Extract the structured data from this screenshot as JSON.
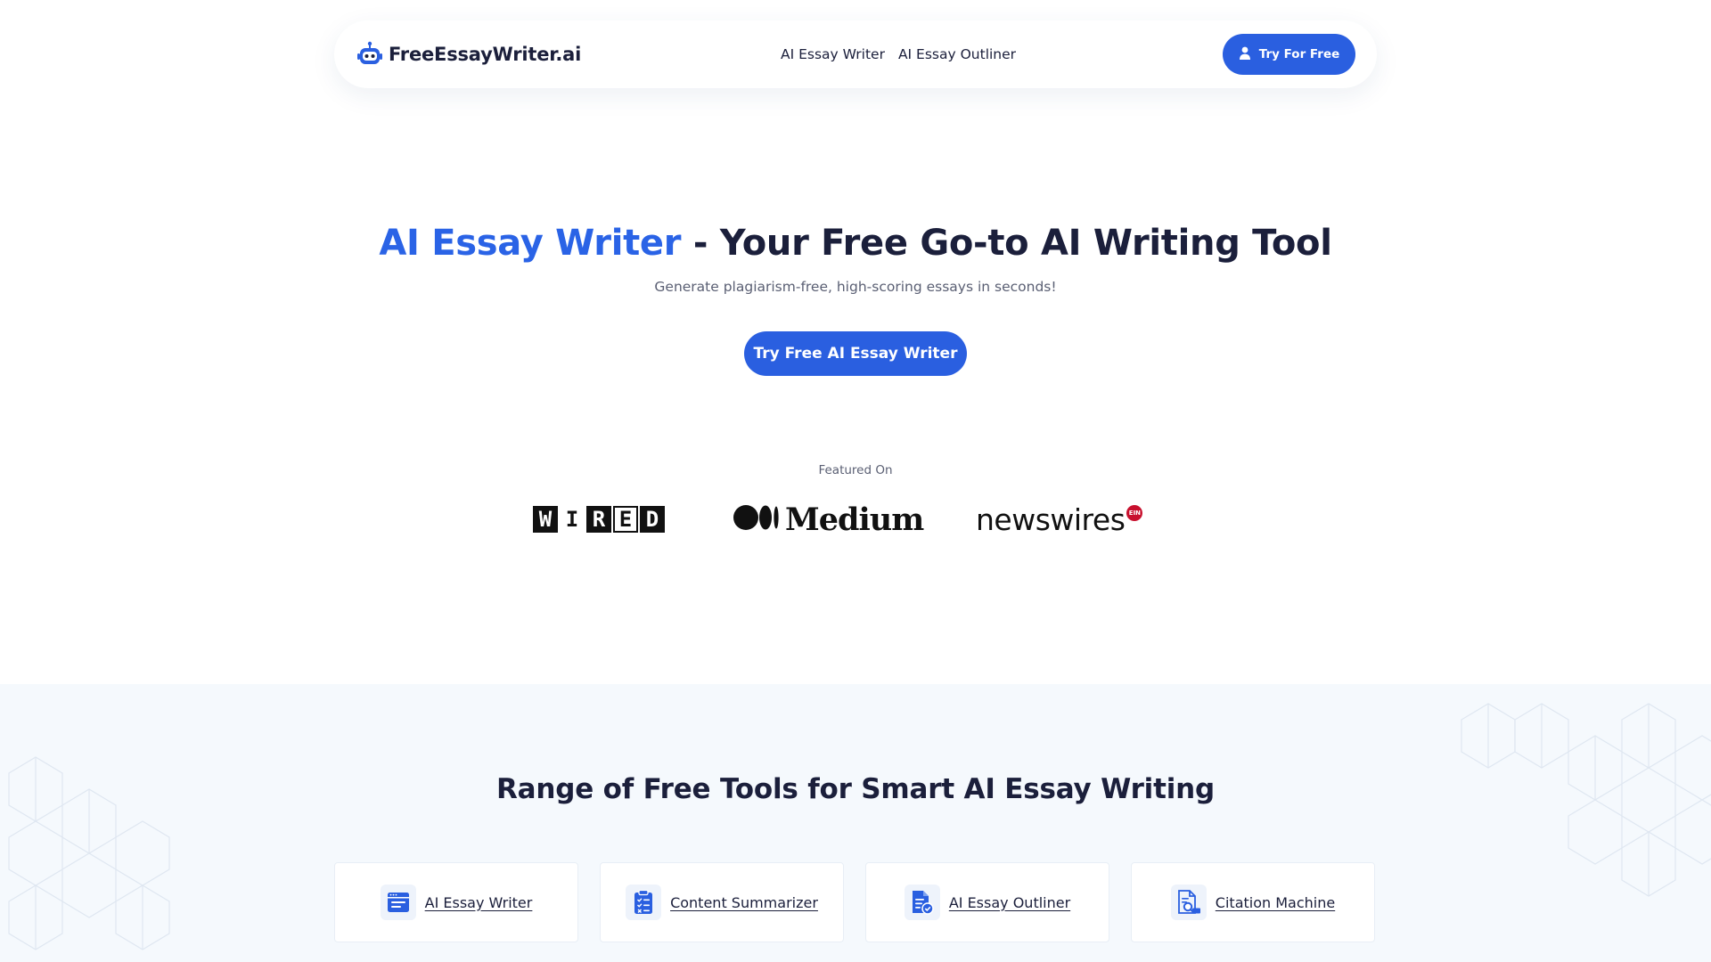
{
  "brand": {
    "name": "FreeEssayWriter.ai",
    "logo_icon": "robot-icon"
  },
  "nav": {
    "links": [
      {
        "label": "AI Essay Writer"
      },
      {
        "label": "AI Essay Outliner"
      }
    ],
    "cta_label": "Try For Free",
    "cta_icon": "user-icon"
  },
  "hero": {
    "title_accent": "AI Essay Writer",
    "title_rest": " - Your Free Go-to AI Writing Tool",
    "subtitle": "Generate plagiarism-free, high-scoring essays in seconds!",
    "cta_label": "Try Free AI Essay Writer"
  },
  "featured": {
    "label": "Featured On",
    "logos": {
      "wired": [
        "W",
        "I",
        "R",
        "E",
        "D"
      ],
      "medium": "Medium",
      "newswires": "newswires",
      "newswires_badge": "EIN"
    }
  },
  "tools": {
    "title": "Range of Free Tools for Smart AI Essay Writing",
    "items": [
      {
        "label": "AI Essay Writer",
        "icon": "browser-window-icon"
      },
      {
        "label": "Content Summarizer",
        "icon": "clipboard-checklist-icon"
      },
      {
        "label": "AI Essay Outliner",
        "icon": "document-check-icon"
      },
      {
        "label": "Citation Machine",
        "icon": "document-search-icon"
      }
    ]
  },
  "colors": {
    "primary": "#2a5fe0",
    "accent_text": "#2a63e6",
    "heading": "#1b1f3b",
    "muted": "#5a5f73",
    "section_bg": "#f5f9fd",
    "ein_red": "#c8102e"
  }
}
